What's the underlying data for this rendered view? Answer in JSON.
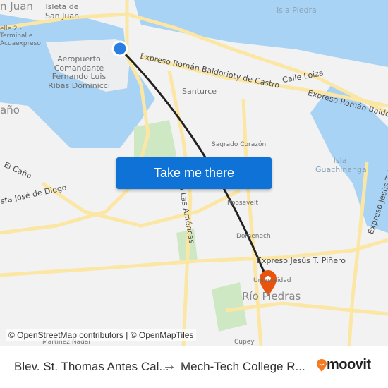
{
  "map": {
    "labels": {
      "san_juan": "n Juan",
      "isleta": "Isleta de San Juan",
      "terminal": "elle 2 - Terminal e Acuaexpreso",
      "isla_piedra": "Isla Piedra",
      "airport": "Aeropuerto Comandante Fernando Luis Ribas Dominicci",
      "expreso_baldorioty": "Expreso Román Baldorioty de Castro",
      "calle_loiza": "Calle Loíza",
      "expreso_baldorioty_2": "Expreso Román Baldorioty",
      "santurce": "Santurce",
      "cano": "año",
      "sagrado": "Sagrado Corazón",
      "isla_guachinanga": "Isla Guachinanga",
      "el_cano": "El Caño",
      "jose_de_diego": "sta José de Diego",
      "las_americas": "o Las Américas",
      "roosevelt": "Roosevelt",
      "domenech": "Domenech",
      "jesus_pinero": "Expreso Jesús T. Piñero",
      "jesus_pinero_v": "Expreso Jesús T. Piñero",
      "universidad": "Universidad",
      "rio_piedras": "Río Piedras",
      "cupey": "Cupey",
      "martinez_nadal": "Martínez Nadal"
    },
    "cta_label": "Take me there",
    "attribution": "© OpenStreetMap contributors | © OpenMapTiles",
    "colors": {
      "water": "#a9d3f5",
      "land": "#f2f2f2",
      "road": "#fbe7a3",
      "park": "#cfe8c4",
      "route": "#222222",
      "origin": "#2a7de1",
      "destination": "#e8530e",
      "cta": "#0f72d6"
    }
  },
  "footer": {
    "from": "Blev. St. Thomas Antes Cal...",
    "arrow": "→",
    "to": "Mech-Tech College R...",
    "brand": "moovit"
  }
}
